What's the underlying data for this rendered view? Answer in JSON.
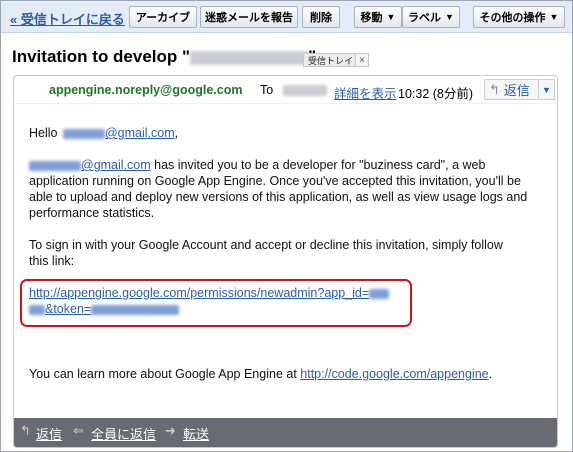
{
  "toolbar": {
    "back_label": "« 受信トレイに戻る",
    "archive_label": "アーカイブ",
    "spam_label": "迷惑メールを報告",
    "delete_label": "削除",
    "move_label": "移動",
    "labels_label": "ラベル",
    "more_actions_label": "その他の操作"
  },
  "subject": {
    "prefix": "Invitation to develop \"",
    "suffix": "\"",
    "label_tag": "受信トレイ",
    "label_remove": "×"
  },
  "message": {
    "sender": "appengine.noreply@google.com",
    "to_label": "To",
    "details_label": "詳細を表示",
    "time": "10:32 (8分前)",
    "reply_label": "返信",
    "more_icon": "▼",
    "greeting_prefix": "Hello",
    "greeting_email_suffix": "@gmail.com",
    "greeting_end": ",",
    "invite_email_suffix": "@gmail.com",
    "invite_line1": " has invited you to be a developer for \"buziness card\", a web",
    "invite_line2": "application running on Google App Engine.  Once you've accepted this invitation, you'll be",
    "invite_line3": "able to upload and deploy new versions of this application, as well as view usage logs and",
    "invite_line4": "performance statistics.",
    "signin_line1": "To sign in with your Google Account and accept or decline this invitation, simply follow",
    "signin_line2": "this link:",
    "link_line1": "http://appengine.google.com/permissions/newadmin?app_id=",
    "link_line2": "&token=",
    "learn_prefix": "You can learn more about Google App Engine at ",
    "learn_link": "http://code.google.com/appengine",
    "learn_suffix": "."
  },
  "footer": {
    "reply_label": "返信",
    "reply_all_label": "全員に返信",
    "forward_label": "転送"
  },
  "colors": {
    "link": "#2a5db0",
    "sender": "#1c7a2a",
    "highlight": "#d0121b",
    "footer_bg": "#686b71"
  }
}
